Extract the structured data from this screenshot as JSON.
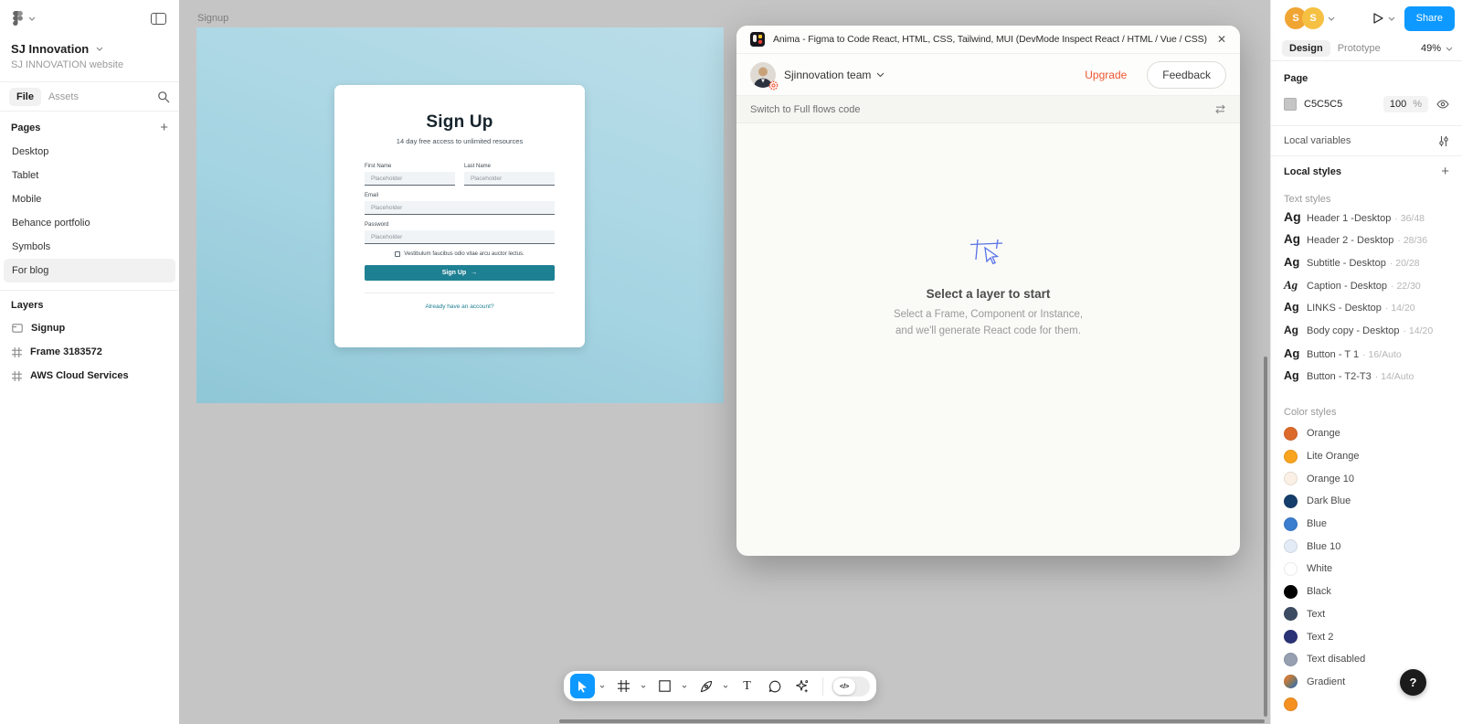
{
  "icons": {
    "close": "✕",
    "plus": "+",
    "arrow_right": "→",
    "help": "?",
    "dev_code": "</>",
    "text_tool": "T"
  },
  "left_sidebar": {
    "workspace_name": "SJ Innovation",
    "project_name": "SJ INNOVATION website",
    "tabs": {
      "file": "File",
      "assets": "Assets"
    },
    "pages_header": "Pages",
    "pages": [
      {
        "label": "Desktop",
        "active": false
      },
      {
        "label": "Tablet",
        "active": false
      },
      {
        "label": "Mobile",
        "active": false
      },
      {
        "label": "Behance portfolio",
        "active": false
      },
      {
        "label": "Symbols",
        "active": false
      },
      {
        "label": "For blog",
        "active": true
      }
    ],
    "layers_header": "Layers",
    "layers": [
      {
        "label": "Signup",
        "icon": "section"
      },
      {
        "label": "Frame 3183572",
        "icon": "frame"
      },
      {
        "label": "AWS Cloud Services",
        "icon": "frame"
      }
    ]
  },
  "canvas": {
    "frame_label": "Signup",
    "signup_form": {
      "title": "Sign Up",
      "subtitle": "14 day free access to unlimited resources",
      "fields": [
        {
          "label": "First Name",
          "placeholder": "Placeholder"
        },
        {
          "label": "Last Name",
          "placeholder": "Placeholder"
        },
        {
          "label": "Email",
          "placeholder": "Placeholder"
        },
        {
          "label": "Password",
          "placeholder": "Placeholder"
        }
      ],
      "checkbox_label": "Vestibulum faucibus odio vitae arcu auctor lectus.",
      "submit_label": "Sign Up",
      "signin_link": "Already have an account?",
      "button_color": "#1e8093"
    }
  },
  "modal": {
    "title": "Anima - Figma to Code React, HTML, CSS, Tailwind, MUI (DevMode Inspect React / HTML / Vue / CSS)",
    "team_name": "Sjinnovation team",
    "upgrade_label": "Upgrade",
    "feedback_label": "Feedback",
    "switch_label": "Switch to Full flows code",
    "empty_state": {
      "heading": "Select a layer to start",
      "line1": "Select a Frame, Component or Instance,",
      "line2": "and we'll generate React code for them."
    }
  },
  "right_panel": {
    "avatars": {
      "a1": "S",
      "a2": "S"
    },
    "share_label": "Share",
    "tabs": {
      "design": "Design",
      "prototype": "Prototype"
    },
    "zoom_level": "49%",
    "page_section": {
      "header": "Page",
      "hex": "C5C5C5",
      "swatch": "#C5C5C5",
      "opacity": "100",
      "percent": "%"
    },
    "local_variables_label": "Local variables",
    "local_styles_label": "Local styles",
    "text_styles_header": "Text styles",
    "text_styles": [
      {
        "sample": "Ag",
        "name": "Header 1 -Desktop",
        "size": "36/48",
        "ag_px": "14px",
        "italic": false
      },
      {
        "sample": "Ag",
        "name": "Header 2 - Desktop",
        "size": "28/36",
        "ag_px": "13.5px",
        "italic": false
      },
      {
        "sample": "Ag",
        "name": "Subtitle - Desktop",
        "size": "20/28",
        "ag_px": "13px",
        "italic": false
      },
      {
        "sample": "Ag",
        "name": "Caption - Desktop",
        "size": "22/30",
        "ag_px": "13px",
        "italic": true
      },
      {
        "sample": "Ag",
        "name": "LINKS - Desktop",
        "size": "14/20",
        "ag_px": "12.5px",
        "italic": false
      },
      {
        "sample": "Ag",
        "name": "Body copy - Desktop",
        "size": "14/20",
        "ag_px": "12px",
        "italic": false
      },
      {
        "sample": "Ag",
        "name": "Button - T 1",
        "size": "16/Auto",
        "ag_px": "13px",
        "italic": false
      },
      {
        "sample": "Ag",
        "name": "Button - T2-T3",
        "size": "14/Auto",
        "ag_px": "12.5px",
        "italic": false
      }
    ],
    "color_styles_header": "Color styles",
    "color_styles": [
      {
        "name": "Orange",
        "css": "#DB6A2B"
      },
      {
        "name": "Lite Orange",
        "css": "#F9A41F"
      },
      {
        "name": "Orange 10",
        "css": "#FAF0E5"
      },
      {
        "name": "Dark Blue",
        "css": "#163E6C"
      },
      {
        "name": "Blue",
        "css": "#3B7DCE"
      },
      {
        "name": "Blue 10",
        "css": "#E3EBF6"
      },
      {
        "name": "White",
        "css": "#FFFFFF"
      },
      {
        "name": "Black",
        "css": "#000000"
      },
      {
        "name": "Text",
        "css": "#3E4C63"
      },
      {
        "name": "Text 2",
        "css": "#2B3377"
      },
      {
        "name": "Text disabled",
        "css": "#96A0B1"
      },
      {
        "name": "Gradient",
        "css": "linear-gradient(135deg,#d07c3c 25%,#85785f 55%,#4c6fa0 80%)"
      },
      {
        "name": "",
        "css": "#F59120"
      }
    ]
  }
}
